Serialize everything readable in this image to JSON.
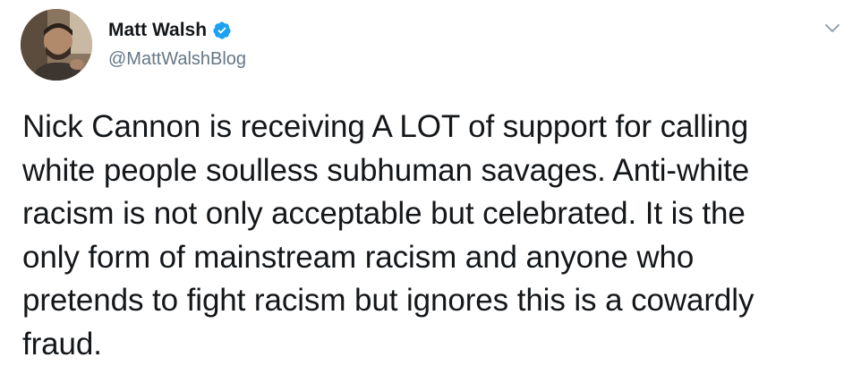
{
  "author": {
    "display_name": "Matt Walsh",
    "handle": "@MattWalshBlog",
    "verified": true
  },
  "tweet": {
    "text": "Nick Cannon is receiving A LOT of support for calling\nwhite people soulless subhuman savages. Anti-white\nracism is not only acceptable but celebrated. It is the\nonly form of mainstream racism and anyone who\npretends to fight racism but ignores this is a cowardly\nfraud."
  },
  "icons": {
    "verified": "verified-badge-icon",
    "menu": "chevron-down-icon"
  },
  "colors": {
    "verified_blue": "#1da1f2",
    "handle_gray": "#657786",
    "text": "#14171a"
  }
}
